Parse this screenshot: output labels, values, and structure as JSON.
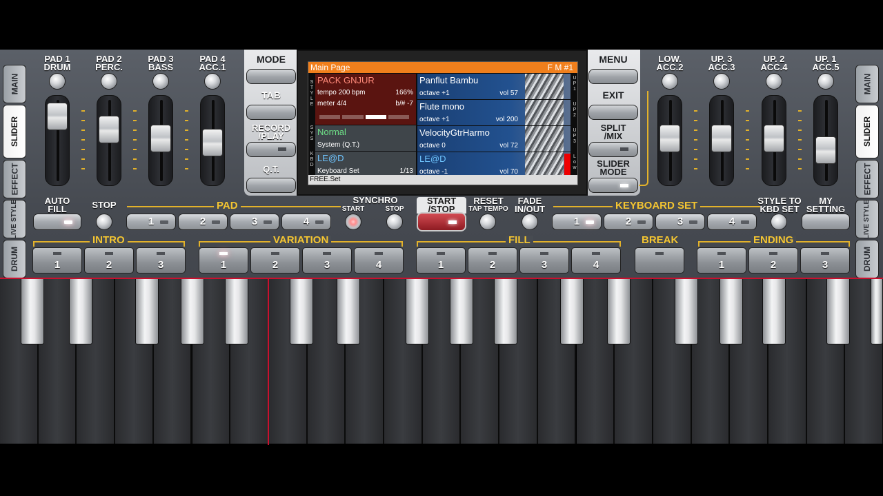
{
  "side_tabs_left": [
    "MAIN",
    "SLIDER",
    "EFFECT",
    "LIVE STYLE",
    "DRUM"
  ],
  "side_tabs_right": [
    "MAIN",
    "SLIDER",
    "EFFECT",
    "LIVE STYLE",
    "DRUM"
  ],
  "left_channels": [
    {
      "line1": "PAD 1",
      "line2": "DRUM"
    },
    {
      "line1": "PAD 2",
      "line2": "PERC."
    },
    {
      "line1": "PAD 3",
      "line2": "BASS"
    },
    {
      "line1": "PAD 4",
      "line2": "ACC.1"
    }
  ],
  "right_channels": [
    {
      "line1": "LOW.",
      "line2": "ACC.2"
    },
    {
      "line1": "UP. 3",
      "line2": "ACC.3"
    },
    {
      "line1": "UP. 2",
      "line2": "ACC.4"
    },
    {
      "line1": "UP. 1",
      "line2": "ACC.5"
    }
  ],
  "left_panel": {
    "mode": "MODE",
    "tab": "TAB",
    "record_l1": "RECORD",
    "record_l2": "/PLAY",
    "qt": "Q.T."
  },
  "right_panel": {
    "menu": "MENU",
    "exit": "EXIT",
    "split_l1": "SPLIT",
    "split_l2": "/MIX",
    "slider_l1": "SLIDER",
    "slider_l2": "MODE"
  },
  "screen": {
    "title": "Main Page",
    "title_right": "F M #1",
    "style_name": "PACK GNJUR",
    "tempo": "tempo 200 bpm",
    "tempo_pct": "166%",
    "meter": "meter 4/4",
    "key": "b/# -7",
    "sys_name": "Normal",
    "sys_sub": "System (Q.T.)",
    "kbd_name": "LE@D",
    "kbd_sub": "Keyboard Set",
    "kbd_count": "1/13",
    "voices": [
      {
        "name": "Panflut Bambu",
        "octave": "octave +1",
        "vol": "vol 57",
        "side": "UP1"
      },
      {
        "name": "Flute mono",
        "octave": "octave +1",
        "vol": "vol 200",
        "side": "UP2"
      },
      {
        "name": "VelocityGtrHarmo",
        "octave": "octave  0",
        "vol": "vol 72",
        "side": "UP3"
      },
      {
        "name": "LE@D",
        "octave": "octave -1",
        "vol": "vol 70",
        "side": "Low"
      }
    ],
    "footer": "FREE.Set",
    "vl_style": "STYLE",
    "vl_sys": "SYS",
    "vl_kbd": "KBD"
  },
  "row1": {
    "auto_l1": "AUTO",
    "auto_l2": "FILL",
    "stop": "STOP",
    "pad": "PAD",
    "pad_buttons": [
      "1",
      "2",
      "3",
      "4"
    ],
    "synchro": "SYNCHRO",
    "sync_start": "START",
    "sync_stop": "STOP",
    "start_l1": "START",
    "start_l2": "/STOP",
    "reset": "RESET",
    "tap": "TAP TEMPO",
    "fade_l1": "FADE",
    "fade_l2": "IN/OUT",
    "kbdset": "KEYBOARD SET",
    "kbd_buttons": [
      "1",
      "2",
      "3",
      "4"
    ],
    "styleto_l1": "STYLE TO",
    "styleto_l2": "KBD SET",
    "my_l1": "MY",
    "my_l2": "SETTING"
  },
  "row2": {
    "intro": "INTRO",
    "intro_buttons": [
      "1",
      "2",
      "3"
    ],
    "variation": "VARIATION",
    "variation_buttons": [
      "1",
      "2",
      "3",
      "4"
    ],
    "fill": "FILL",
    "fill_buttons": [
      "1",
      "2",
      "3",
      "4"
    ],
    "break": "BREAK",
    "ending": "ENDING",
    "ending_buttons": [
      "1",
      "2",
      "3"
    ]
  },
  "colors": {
    "accent": "#f4c531",
    "orange_header": "#f07f1c",
    "red_line": "#c8102e"
  },
  "sliders_left_level": [
    0.93,
    0.7,
    0.55,
    0.48
  ],
  "sliders_right_level": [
    0.55,
    0.55,
    0.55,
    0.35
  ]
}
